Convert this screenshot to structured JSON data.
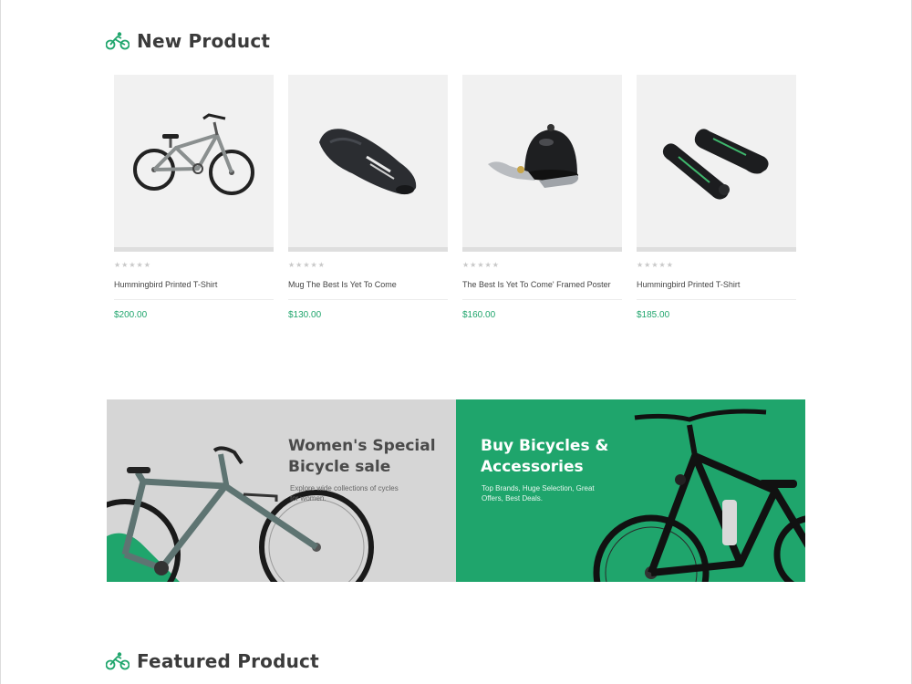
{
  "new_section": {
    "title": "New Product",
    "icon": "cyclist-icon"
  },
  "products": [
    {
      "name": "Hummingbird Printed T-Shirt",
      "price": "$200.00",
      "stars": "★★★★★",
      "image": "mountain-bike"
    },
    {
      "name": "Mug The Best Is Yet To Come",
      "price": "$130.00",
      "stars": "★★★★★",
      "image": "bike-saddle"
    },
    {
      "name": "The Best Is Yet To Come' Framed Poster",
      "price": "$160.00",
      "stars": "★★★★★",
      "image": "bike-bell"
    },
    {
      "name": "Hummingbird Printed T-Shirt",
      "price": "$185.00",
      "stars": "★★★★★",
      "image": "bar-ends"
    }
  ],
  "banners": {
    "left": {
      "title": "Women's Special Bicycle sale",
      "subtitle": "Explore wide collections of cycles for women."
    },
    "right": {
      "title": "Buy Bicycles & Accessories",
      "subtitle": "Top Brands, Huge Selection, Great Offers, Best Deals."
    }
  },
  "featured_section": {
    "title": "Featured Product",
    "icon": "cyclist-icon"
  },
  "colors": {
    "accent": "#1fa56c",
    "banner_grey": "#d6d6d6",
    "card_bg": "#f1f1f1"
  }
}
